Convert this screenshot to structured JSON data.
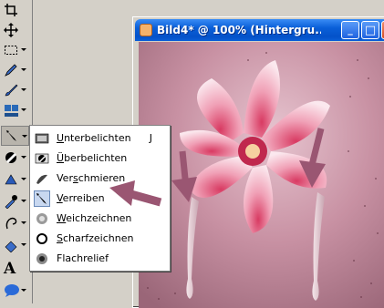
{
  "window": {
    "title": "Bild4* @ 100% (Hintergru...",
    "buttons": {
      "minimize": "_",
      "maximize": "□",
      "close": "✕"
    }
  },
  "toolbar": {
    "tools": [
      {
        "name": "crop-tool",
        "icon": "crop-icon"
      },
      {
        "name": "move-tool",
        "icon": "move-icon"
      },
      {
        "name": "marquee-tool",
        "icon": "marquee-icon"
      },
      {
        "name": "pencil-tool",
        "icon": "pencil-icon"
      },
      {
        "name": "brush-tool",
        "icon": "brush-icon"
      },
      {
        "name": "stamp-tool",
        "icon": "stamp-icon"
      },
      {
        "name": "smudge-tool",
        "icon": "smudge-icon",
        "active": true
      },
      {
        "name": "dodge-tool",
        "icon": "dodge-icon"
      },
      {
        "name": "sponge-tool",
        "icon": "sponge-icon"
      },
      {
        "name": "eyedropper-tool",
        "icon": "eyedropper-icon"
      },
      {
        "name": "lasso-tool",
        "icon": "lasso-icon"
      },
      {
        "name": "eraser-tool",
        "icon": "eraser-icon"
      },
      {
        "name": "text-tool",
        "icon": "text-icon",
        "glyph": "A"
      },
      {
        "name": "shape-tool",
        "icon": "speech-bubble-icon"
      }
    ]
  },
  "menu": {
    "items": [
      {
        "pre": "",
        "acc": "U",
        "post": "nterbelichten",
        "shortcut": "J",
        "icon": "underexpose-icon"
      },
      {
        "pre": "",
        "acc": "Ü",
        "post": "berbelichten",
        "shortcut": "",
        "icon": "overexpose-icon"
      },
      {
        "pre": "Ver",
        "acc": "s",
        "post": "chmieren",
        "shortcut": "",
        "icon": "smear-icon"
      },
      {
        "pre": "",
        "acc": "V",
        "post": "erreiben",
        "shortcut": "",
        "icon": "smudge-finger-icon",
        "selected": true
      },
      {
        "pre": "",
        "acc": "W",
        "post": "eichzeichnen",
        "shortcut": "",
        "icon": "blur-icon"
      },
      {
        "pre": "",
        "acc": "S",
        "post": "charfzeichnen",
        "shortcut": "",
        "icon": "sharpen-icon"
      },
      {
        "pre": "",
        "acc": "",
        "post": "Flachrelief",
        "shortcut": "",
        "icon": "emboss-icon"
      }
    ]
  },
  "colors": {
    "canvas_bg": "#c08a9c",
    "annotation_arrow": "#9a5672",
    "titlebar": "#0a5fd8"
  }
}
